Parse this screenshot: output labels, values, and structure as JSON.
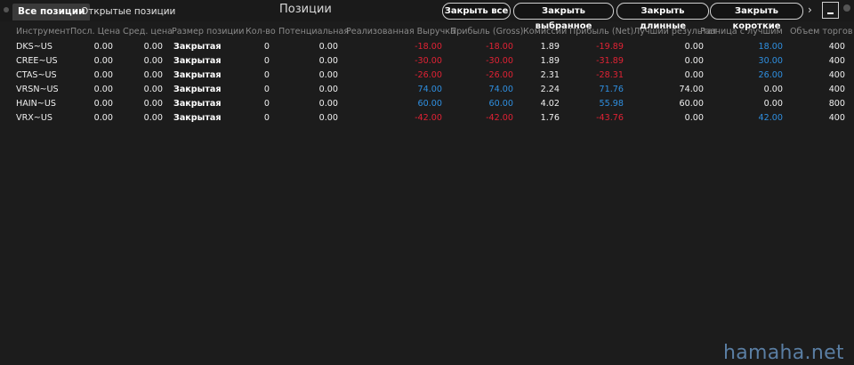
{
  "tabs": {
    "all": "Все позиции",
    "open": "Открытые позиции"
  },
  "title": "Позиции",
  "toolbar": {
    "close_all": "Закрыть все",
    "close_selected": "Закрыть выбранное",
    "close_long": "Закрыть длинные",
    "close_short": "Закрыть короткие",
    "more": "›"
  },
  "columns": [
    "Инструмент",
    "Посл. Цена",
    "Сред. цена",
    "Размер позиции",
    "Кол-во",
    "Потенциальная",
    "Реализованная Выручка",
    "Прибыль (Gross)",
    "Комиссии",
    "Прибыль (Net)",
    "Лучший результат",
    "Разница с лучшим",
    "Объем торгов"
  ],
  "rows": [
    [
      "DKS~US",
      "0.00",
      "0.00",
      "Закрытая",
      "0",
      "0.00",
      "-18.00",
      "-18.00",
      "1.89",
      "-19.89",
      "0.00",
      "18.00",
      "400"
    ],
    [
      "CREE~US",
      "0.00",
      "0.00",
      "Закрытая",
      "0",
      "0.00",
      "-30.00",
      "-30.00",
      "1.89",
      "-31.89",
      "0.00",
      "30.00",
      "400"
    ],
    [
      "CTAS~US",
      "0.00",
      "0.00",
      "Закрытая",
      "0",
      "0.00",
      "-26.00",
      "-26.00",
      "2.31",
      "-28.31",
      "0.00",
      "26.00",
      "400"
    ],
    [
      "VRSN~US",
      "0.00",
      "0.00",
      "Закрытая",
      "0",
      "0.00",
      "74.00",
      "74.00",
      "2.24",
      "71.76",
      "74.00",
      "0.00",
      "400"
    ],
    [
      "HAIN~US",
      "0.00",
      "0.00",
      "Закрытая",
      "0",
      "0.00",
      "60.00",
      "60.00",
      "4.02",
      "55.98",
      "60.00",
      "0.00",
      "800"
    ],
    [
      "VRX~US",
      "0.00",
      "0.00",
      "Закрытая",
      "0",
      "0.00",
      "-42.00",
      "-42.00",
      "1.76",
      "-43.76",
      "0.00",
      "42.00",
      "400"
    ]
  ],
  "watermark": "hamaha.net",
  "colors": {
    "negative": "#e02234",
    "positive": "#2f8fe0",
    "background": "#1c1c1c"
  }
}
